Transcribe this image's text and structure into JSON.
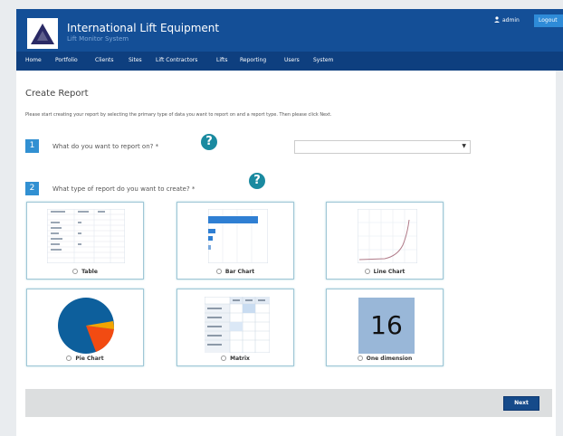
{
  "header": {
    "title": "International Lift Equipment",
    "subtitle": "Lift Monitor System",
    "admin_label": "admin",
    "logout_label": "Logout"
  },
  "nav": {
    "items": [
      "Home",
      "Portfolio",
      "Clients",
      "Sites",
      "Lift Contractors",
      "Lifts",
      "Reporting",
      "Users",
      "System"
    ]
  },
  "page": {
    "title": "Create Report",
    "instructions": "Please start creating your report by selecting the primary type of data you want to report on and a report type. Then please click Next."
  },
  "steps": [
    {
      "number": "1",
      "label": "What do you want to report on? *"
    },
    {
      "number": "2",
      "label": "What type of report do you want to create? *"
    }
  ],
  "help_glyph": "?",
  "select": {
    "value": ""
  },
  "report_types": [
    {
      "label": "Table",
      "icon": "table-preview-icon"
    },
    {
      "label": "Bar Chart",
      "icon": "bar-chart-preview-icon"
    },
    {
      "label": "Line Chart",
      "icon": "line-chart-preview-icon"
    },
    {
      "label": "Pie Chart",
      "icon": "pie-chart-preview-icon"
    },
    {
      "label": "Matrix",
      "icon": "matrix-preview-icon"
    },
    {
      "label": "One dimension",
      "icon": "number-preview-icon",
      "value": "16"
    }
  ],
  "footer": {
    "next_label": "Next"
  },
  "colors": {
    "header": "#144f97",
    "nav": "#0e3f7f",
    "accent": "#3190d2",
    "help": "#1a8aa0",
    "pie_main": "#0d5f9c",
    "pie_slice": "#f24b12",
    "pie_slice_2": "#f2a400",
    "number_tile": "#99b7d8"
  }
}
